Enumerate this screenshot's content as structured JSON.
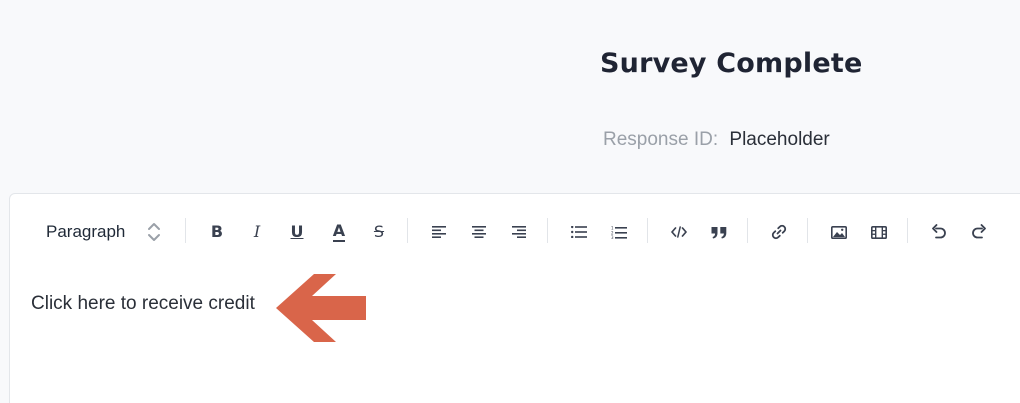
{
  "header": {
    "title": "Survey Complete",
    "response_label": "Response ID:",
    "response_value": "Placeholder"
  },
  "toolbar": {
    "block_format": "Paragraph",
    "buttons": [
      {
        "name": "bold",
        "icon": "bold-icon",
        "glyph": "B"
      },
      {
        "name": "italic",
        "icon": "italic-icon",
        "glyph": "I"
      },
      {
        "name": "underline",
        "icon": "underline-icon",
        "glyph": "U"
      },
      {
        "name": "text-color",
        "icon": "text-color-icon",
        "glyph": "A"
      },
      {
        "name": "strikethrough",
        "icon": "strikethrough-icon",
        "glyph": "S"
      },
      {
        "name": "align-left",
        "icon": "align-left-icon"
      },
      {
        "name": "align-center",
        "icon": "align-center-icon"
      },
      {
        "name": "align-right",
        "icon": "align-right-icon"
      },
      {
        "name": "bullet-list",
        "icon": "bullet-list-icon"
      },
      {
        "name": "numbered-list",
        "icon": "numbered-list-icon"
      },
      {
        "name": "code",
        "icon": "code-icon"
      },
      {
        "name": "blockquote",
        "icon": "quote-icon"
      },
      {
        "name": "link",
        "icon": "link-icon"
      },
      {
        "name": "image",
        "icon": "image-icon"
      },
      {
        "name": "video",
        "icon": "film-icon"
      },
      {
        "name": "undo",
        "icon": "undo-icon"
      },
      {
        "name": "redo",
        "icon": "redo-icon"
      }
    ]
  },
  "editor": {
    "content_text": "Click here to receive credit"
  },
  "colors": {
    "background": "#f8f9fb",
    "arrow": "#d9654a",
    "toolbar_icon": "#3a4150",
    "label_muted": "#9aa0a8"
  }
}
